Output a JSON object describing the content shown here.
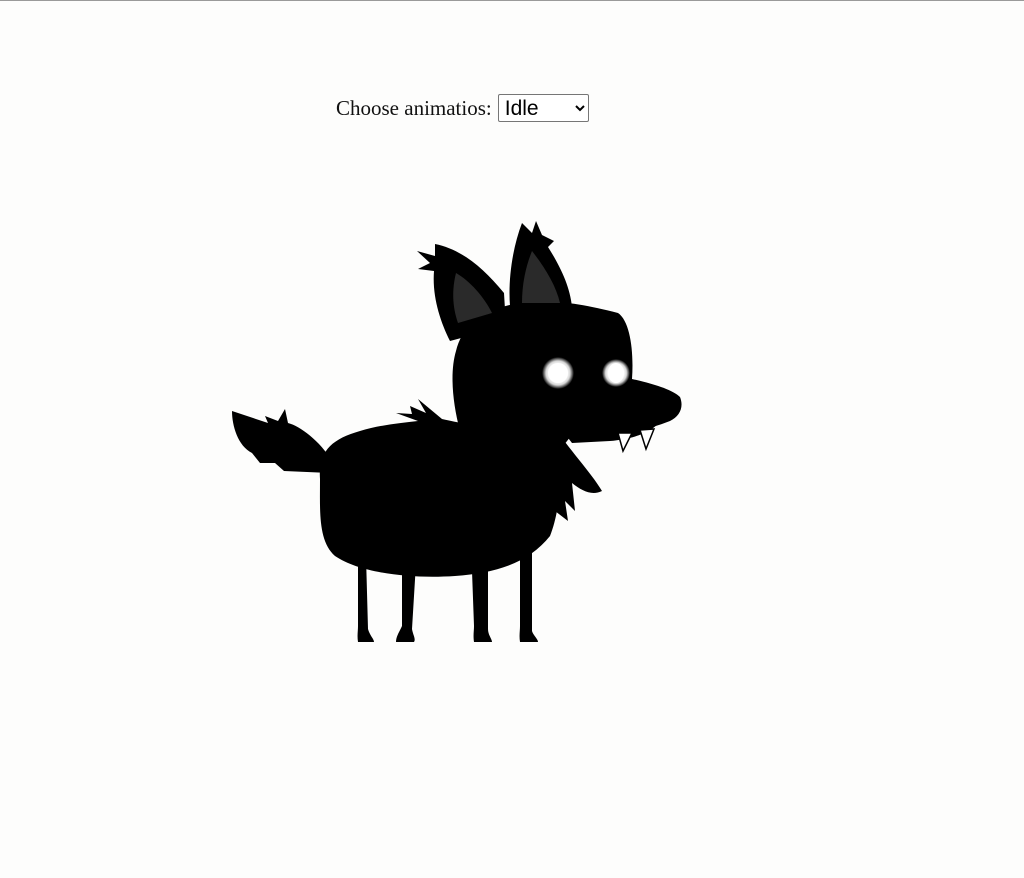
{
  "controls": {
    "label": "Choose animatios:",
    "select": {
      "selected": "Idle",
      "options": [
        "Idle"
      ]
    }
  },
  "character": {
    "icon": "wolf-silhouette",
    "body_color": "#000000",
    "ear_inner_color": "#2a2a2a",
    "eye_color": "#ffffff",
    "eye_glow": "#cfcfcf"
  }
}
